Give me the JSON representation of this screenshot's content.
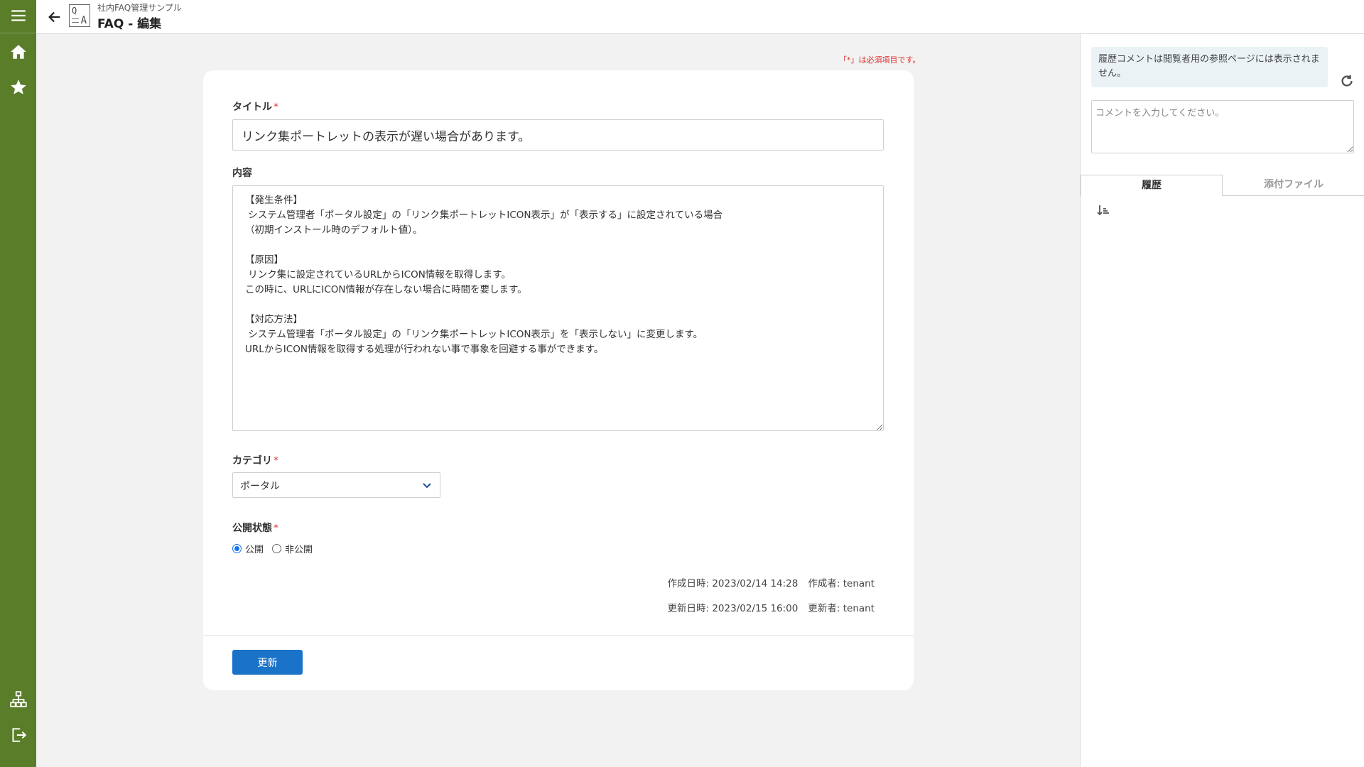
{
  "header": {
    "app_name": "社内FAQ管理サンプル",
    "page_title": "FAQ - 編集"
  },
  "sidebar": {
    "top_items": [
      "menu-icon",
      "home-icon",
      "star-icon"
    ],
    "bottom_items": [
      "sitemap-icon",
      "logout-icon"
    ]
  },
  "form": {
    "required_note": "「*」は必須項目です。",
    "title_label": "タイトル",
    "title_value": "リンク集ポートレットの表示が遅い場合があります。",
    "content_label": "内容",
    "content_value": "【発生条件】\n システム管理者「ポータル設定」の「リンク集ポートレットICON表示」が「表示する」に設定されている場合\n（初期インストール時のデフォルト値）。\n\n【原因】\n リンク集に設定されているURLからICON情報を取得します。\nこの時に、URLにICON情報が存在しない場合に時間を要します。\n\n【対応方法】\n システム管理者「ポータル設定」の「リンク集ポートレットICON表示」を「表示しない」に変更します。\nURLからICON情報を取得する処理が行われない事で事象を回避する事ができます。",
    "category_label": "カテゴリ",
    "category_value": "ポータル",
    "status_label": "公開状態",
    "status_options": [
      "公開",
      "非公開"
    ],
    "status_selected": "公開",
    "required_mark": "*",
    "created_at_label": "作成日時:",
    "created_at": "2023/02/14 14:28",
    "created_by_label": "作成者:",
    "created_by": "tenant",
    "updated_at_label": "更新日時:",
    "updated_at": "2023/02/15 16:00",
    "updated_by_label": "更新者:",
    "updated_by": "tenant",
    "submit_label": "更新"
  },
  "right_panel": {
    "info_text": "履歴コメントは閲覧者用の参照ページには表示されません。",
    "comment_placeholder": "コメントを入力してください。",
    "tabs": [
      "履歴",
      "添付ファイル"
    ],
    "active_tab": "履歴"
  },
  "colors": {
    "sidebar": "#5a7d29",
    "primary_button": "#1a73c9",
    "required": "#dd3333"
  }
}
